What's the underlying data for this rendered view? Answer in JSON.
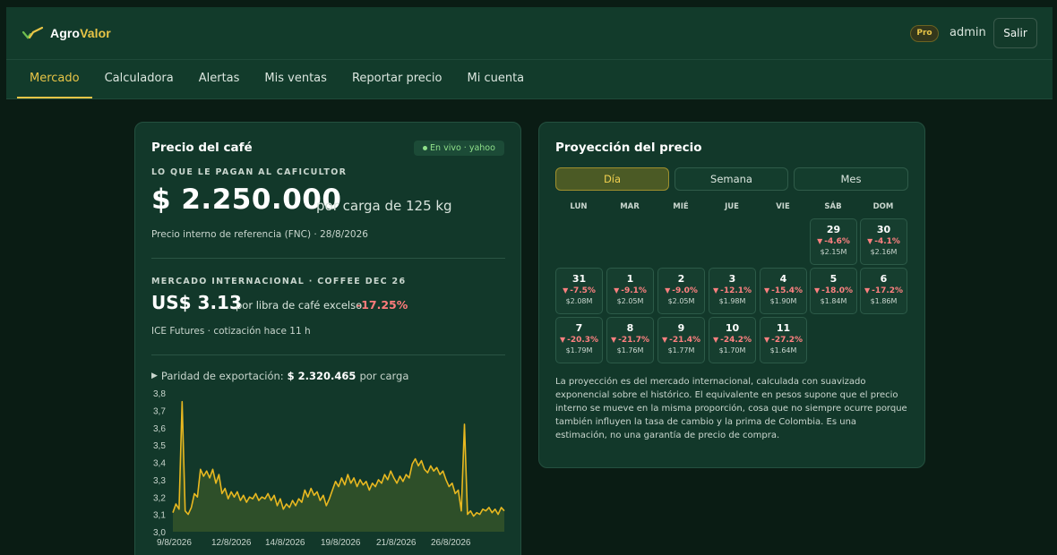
{
  "header": {
    "brand_part1": "Agro",
    "brand_part2": "Valor",
    "plan_badge": "Pro",
    "username": "admin",
    "logout_label": "Salir"
  },
  "nav": {
    "items": [
      {
        "label": "Mercado",
        "active": true
      },
      {
        "label": "Calculadora",
        "active": false
      },
      {
        "label": "Alertas",
        "active": false
      },
      {
        "label": "Mis ventas",
        "active": false
      },
      {
        "label": "Reportar precio",
        "active": false
      },
      {
        "label": "Mi cuenta",
        "active": false
      }
    ]
  },
  "price_card": {
    "title": "Precio del café",
    "live_badge": "En vivo · yahoo",
    "farmer_label": "LO QUE LE PAGAN AL CAFICULTOR",
    "farmer_price": "$ 2.250.000",
    "farmer_unit": "por carga de 125 kg",
    "farmer_note": "Precio interno de referencia (FNC) · 28/8/2026",
    "intl_label": "MERCADO INTERNACIONAL · COFFEE DEC 26",
    "intl_price": "US$ 3.13",
    "intl_unit": "por libra de café excelso",
    "intl_change": "-17.25%",
    "intl_note": "ICE Futures · cotización hace 11 h",
    "parity_label": "Paridad de exportación:",
    "parity_value": "$ 2.320.465",
    "parity_unit": "por carga"
  },
  "chart_data": {
    "type": "line",
    "title": "",
    "xlabel": "",
    "ylabel": "",
    "ylim": [
      3.0,
      3.8
    ],
    "yticks": [
      "3,8",
      "3,7",
      "3,6",
      "3,5",
      "3,4",
      "3,3",
      "3,2",
      "3,1",
      "3,0"
    ],
    "xticks": [
      "9/8/2026",
      "12/8/2026",
      "14/8/2026",
      "19/8/2026",
      "21/8/2026",
      "26/8/2026"
    ],
    "grid": false,
    "series": [
      {
        "values": [
          3.11,
          3.16,
          3.13,
          3.75,
          3.12,
          3.1,
          3.14,
          3.22,
          3.2,
          3.36,
          3.32,
          3.35,
          3.31,
          3.36,
          3.28,
          3.33,
          3.22,
          3.25,
          3.19,
          3.23,
          3.2,
          3.23,
          3.18,
          3.21,
          3.17,
          3.2,
          3.19,
          3.22,
          3.18,
          3.2,
          3.19,
          3.22,
          3.18,
          3.21,
          3.15,
          3.19,
          3.13,
          3.16,
          3.14,
          3.18,
          3.15,
          3.19,
          3.17,
          3.24,
          3.2,
          3.25,
          3.21,
          3.23,
          3.18,
          3.21,
          3.15,
          3.19,
          3.24,
          3.29,
          3.26,
          3.31,
          3.27,
          3.33,
          3.28,
          3.31,
          3.26,
          3.3,
          3.27,
          3.29,
          3.24,
          3.28,
          3.26,
          3.3,
          3.28,
          3.33,
          3.3,
          3.35,
          3.31,
          3.28,
          3.32,
          3.29,
          3.33,
          3.31,
          3.39,
          3.42,
          3.38,
          3.41,
          3.36,
          3.34,
          3.38,
          3.35,
          3.37,
          3.33,
          3.35,
          3.3,
          3.26,
          3.28,
          3.22,
          3.24,
          3.12,
          3.62,
          3.1,
          3.12,
          3.09,
          3.11,
          3.1,
          3.13,
          3.12,
          3.14,
          3.11,
          3.13,
          3.1,
          3.14,
          3.12
        ]
      }
    ]
  },
  "projection_card": {
    "title": "Proyección del precio",
    "tabs": [
      {
        "label": "Día",
        "active": true
      },
      {
        "label": "Semana",
        "active": false
      },
      {
        "label": "Mes",
        "active": false
      }
    ],
    "weekdays": [
      "LUN",
      "MAR",
      "MIÉ",
      "JUE",
      "VIE",
      "SÁB",
      "DOM"
    ],
    "days": [
      {
        "day": "29",
        "change": "-4.6%",
        "value": "$2.15M"
      },
      {
        "day": "30",
        "change": "-4.1%",
        "value": "$2.16M"
      },
      {
        "day": "31",
        "change": "-7.5%",
        "value": "$2.08M"
      },
      {
        "day": "1",
        "change": "-9.1%",
        "value": "$2.05M"
      },
      {
        "day": "2",
        "change": "-9.0%",
        "value": "$2.05M"
      },
      {
        "day": "3",
        "change": "-12.1%",
        "value": "$1.98M"
      },
      {
        "day": "4",
        "change": "-15.4%",
        "value": "$1.90M"
      },
      {
        "day": "5",
        "change": "-18.0%",
        "value": "$1.84M"
      },
      {
        "day": "6",
        "change": "-17.2%",
        "value": "$1.86M"
      },
      {
        "day": "7",
        "change": "-20.3%",
        "value": "$1.79M"
      },
      {
        "day": "8",
        "change": "-21.7%",
        "value": "$1.76M"
      },
      {
        "day": "9",
        "change": "-21.4%",
        "value": "$1.77M"
      },
      {
        "day": "10",
        "change": "-24.2%",
        "value": "$1.70M"
      },
      {
        "day": "11",
        "change": "-27.2%",
        "value": "$1.64M"
      }
    ],
    "note": "La proyección es del mercado internacional, calculada con suavizado exponencial sobre el histórico. El equivalente en pesos supone que el precio interno se mueve en la misma proporción, cosa que no siempre ocurre porque también influyen la tasa de cambio y la prima de Colombia. Es una estimación, no una garantía de precio de compra."
  },
  "colors": {
    "accent": "#e8c547",
    "negative": "#ff7b7b",
    "live": "#8fe08a",
    "chart_line": "#e8b820"
  }
}
